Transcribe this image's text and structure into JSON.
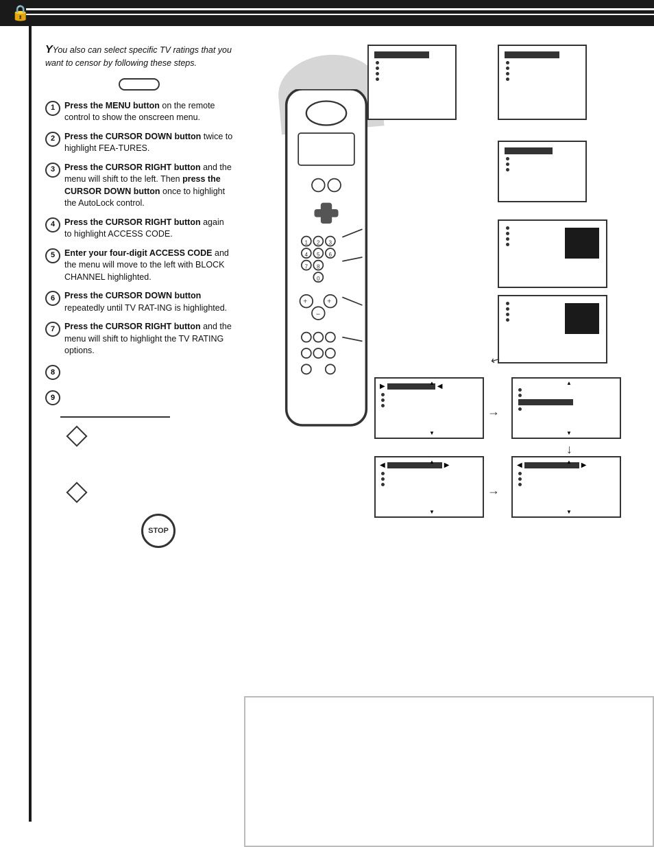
{
  "header": {
    "title": ""
  },
  "intro": {
    "italic_text": "You also can select specific TV ratings that you want to censor by following these steps."
  },
  "steps": [
    {
      "num": "1",
      "text_parts": [
        {
          "bold": true,
          "text": "Press the MENU button"
        },
        {
          "bold": false,
          "text": " on the remote control to show the onscreen menu."
        }
      ]
    },
    {
      "num": "2",
      "text_parts": [
        {
          "bold": true,
          "text": "Press the CURSOR DOWN button"
        },
        {
          "bold": false,
          "text": " twice to highlight FEA-TURES."
        }
      ]
    },
    {
      "num": "3",
      "text_parts": [
        {
          "bold": true,
          "text": "Press the CURSOR RIGHT button"
        },
        {
          "bold": false,
          "text": " and the menu will shift to the left. Then "
        },
        {
          "bold": true,
          "text": "press the CURSOR DOWN button"
        },
        {
          "bold": false,
          "text": " once to highlight the AutoLock control."
        }
      ]
    },
    {
      "num": "4",
      "text_parts": [
        {
          "bold": true,
          "text": "Press the CURSOR RIGHT button"
        },
        {
          "bold": false,
          "text": " again to highlight ACCESS CODE."
        }
      ]
    },
    {
      "num": "5",
      "text_parts": [
        {
          "bold": true,
          "text": "Enter your four-digit ACCESS CODE"
        },
        {
          "bold": false,
          "text": " and the menu will move to the left with BLOCK CHANNEL highlighted."
        }
      ]
    },
    {
      "num": "6",
      "text_parts": [
        {
          "bold": true,
          "text": "Press the CURSOR DOWN button"
        },
        {
          "bold": false,
          "text": " repeatedly until TV RAT-ING is highlighted."
        }
      ]
    },
    {
      "num": "7",
      "text_parts": [
        {
          "bold": true,
          "text": "Press the CURSOR RIGHT button"
        },
        {
          "bold": false,
          "text": " and the menu will shift to highlight the TV RATING options."
        }
      ]
    },
    {
      "num": "8",
      "text_parts": []
    },
    {
      "num": "9",
      "text_parts": []
    }
  ],
  "stop_label": "STOP",
  "icons": {
    "lock": "🔒",
    "menu_btn": "( )",
    "arrow_right": "→",
    "arrow_down": "↓",
    "triangle_up": "▲",
    "triangle_down": "▼"
  }
}
